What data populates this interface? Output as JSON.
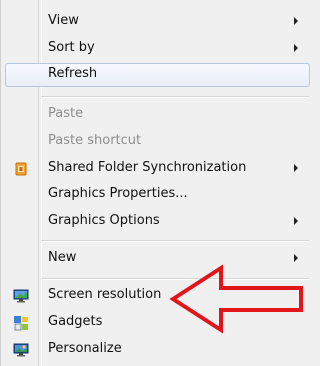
{
  "menu": {
    "items": [
      {
        "label": "View",
        "submenu": true,
        "disabled": false
      },
      {
        "label": "Sort by",
        "submenu": true,
        "disabled": false
      },
      {
        "label": "Refresh",
        "submenu": false,
        "disabled": false,
        "hovered": true
      },
      {
        "label": "Paste",
        "submenu": false,
        "disabled": true
      },
      {
        "label": "Paste shortcut",
        "submenu": false,
        "disabled": true
      },
      {
        "label": "Shared Folder Synchronization",
        "submenu": true,
        "disabled": false,
        "icon": "shared-folder-sync-icon"
      },
      {
        "label": "Graphics Properties...",
        "submenu": false,
        "disabled": false
      },
      {
        "label": "Graphics Options",
        "submenu": true,
        "disabled": false
      },
      {
        "label": "New",
        "submenu": true,
        "disabled": false
      },
      {
        "label": "Screen resolution",
        "submenu": false,
        "disabled": false,
        "icon": "screen-resolution-icon"
      },
      {
        "label": "Gadgets",
        "submenu": false,
        "disabled": false,
        "icon": "gadgets-icon"
      },
      {
        "label": "Personalize",
        "submenu": false,
        "disabled": false,
        "icon": "personalize-icon"
      }
    ]
  },
  "annotation": {
    "arrow_color": "#e0161b",
    "target": "Screen resolution"
  }
}
